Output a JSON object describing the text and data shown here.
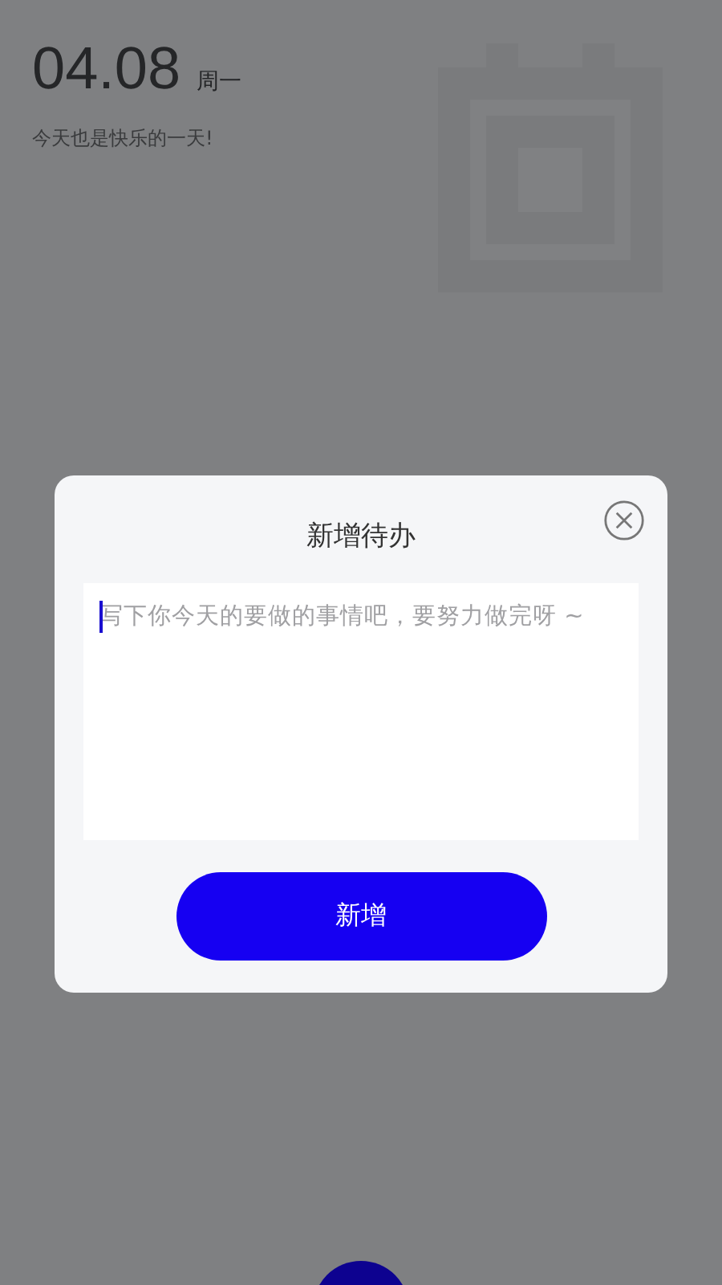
{
  "header": {
    "date": "04.08",
    "weekday": "周一",
    "greeting": "今天也是快乐的一天!"
  },
  "dialog": {
    "title": "新增待办",
    "input": {
      "placeholder": "写下你今天的要做的事情吧，要努力做完呀 ~"
    },
    "submit_button": "新增"
  }
}
